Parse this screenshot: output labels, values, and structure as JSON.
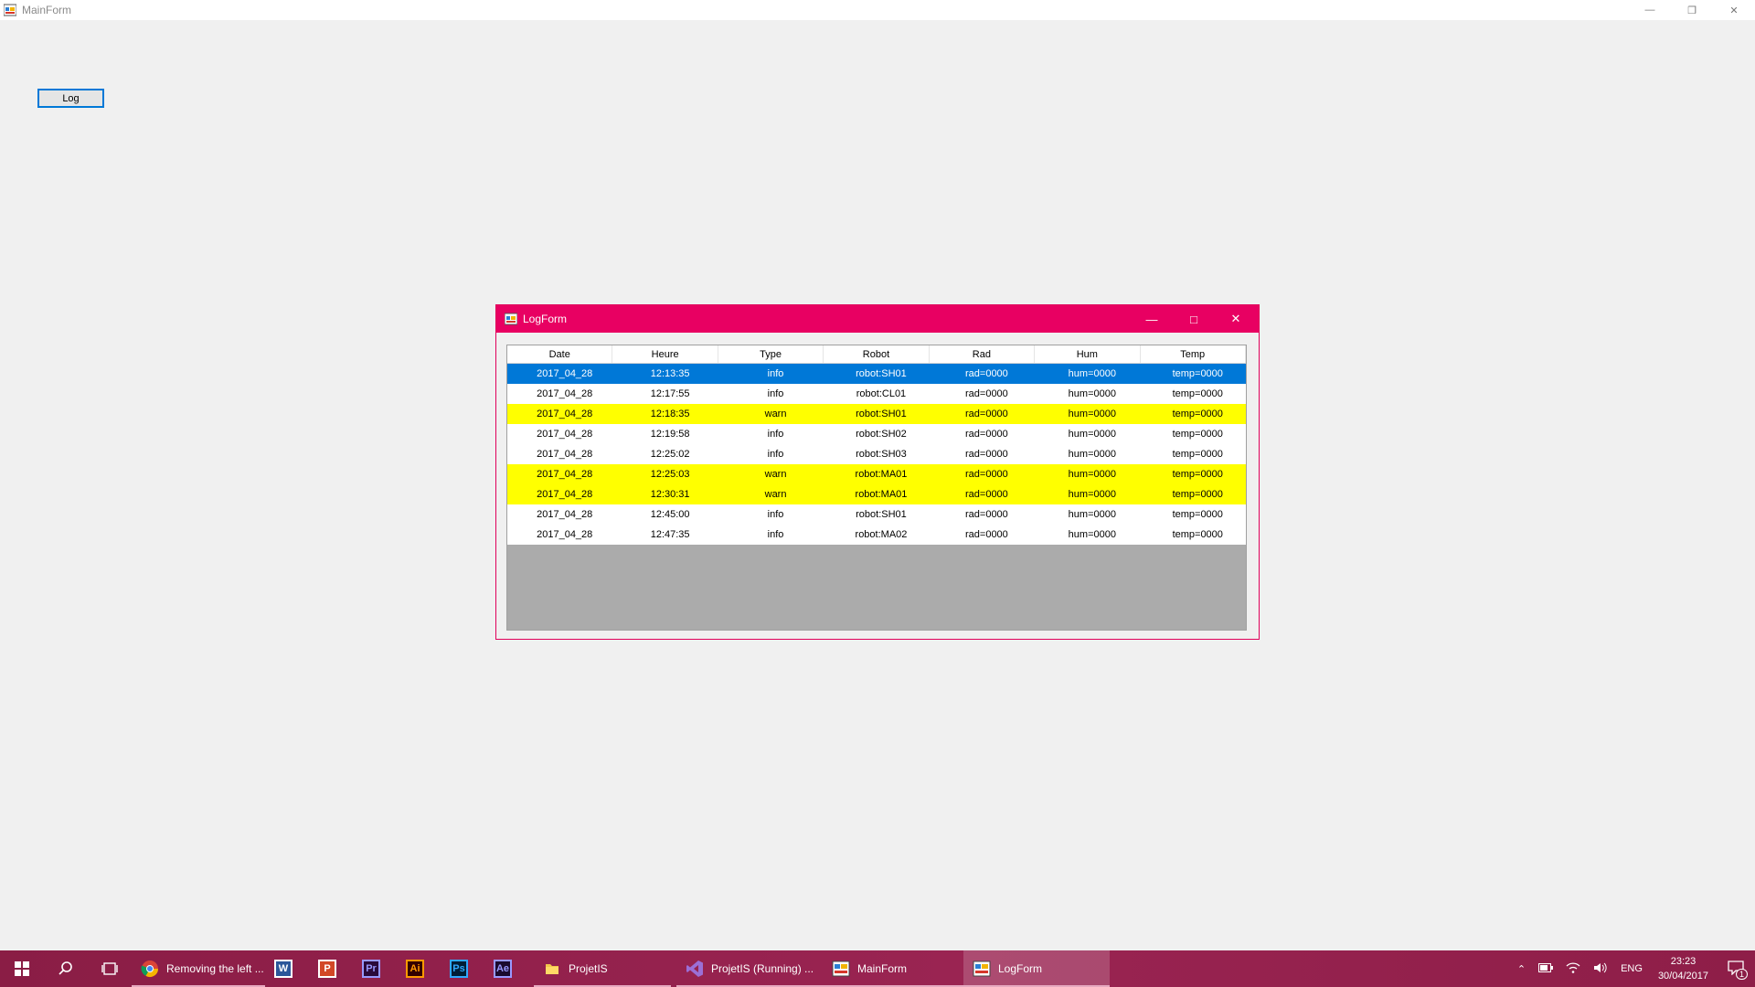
{
  "main_window": {
    "title": "MainForm",
    "log_button_label": "Log"
  },
  "log_window": {
    "title": "LogForm",
    "columns": [
      "Date",
      "Heure",
      "Type",
      "Robot",
      "Rad",
      "Hum",
      "Temp"
    ],
    "rows": [
      {
        "cells": [
          "2017_04_28",
          "12:13:35",
          "info",
          "robot:SH01",
          "rad=0000",
          "hum=0000",
          "temp=0000"
        ],
        "state": "selected"
      },
      {
        "cells": [
          "2017_04_28",
          "12:17:55",
          "info",
          "robot:CL01",
          "rad=0000",
          "hum=0000",
          "temp=0000"
        ],
        "state": "normal"
      },
      {
        "cells": [
          "2017_04_28",
          "12:18:35",
          "warn",
          "robot:SH01",
          "rad=0000",
          "hum=0000",
          "temp=0000"
        ],
        "state": "warn"
      },
      {
        "cells": [
          "2017_04_28",
          "12:19:58",
          "info",
          "robot:SH02",
          "rad=0000",
          "hum=0000",
          "temp=0000"
        ],
        "state": "normal"
      },
      {
        "cells": [
          "2017_04_28",
          "12:25:02",
          "info",
          "robot:SH03",
          "rad=0000",
          "hum=0000",
          "temp=0000"
        ],
        "state": "normal"
      },
      {
        "cells": [
          "2017_04_28",
          "12:25:03",
          "warn",
          "robot:MA01",
          "rad=0000",
          "hum=0000",
          "temp=0000"
        ],
        "state": "warn"
      },
      {
        "cells": [
          "2017_04_28",
          "12:30:31",
          "warn",
          "robot:MA01",
          "rad=0000",
          "hum=0000",
          "temp=0000"
        ],
        "state": "warn"
      },
      {
        "cells": [
          "2017_04_28",
          "12:45:00",
          "info",
          "robot:SH01",
          "rad=0000",
          "hum=0000",
          "temp=0000"
        ],
        "state": "normal"
      },
      {
        "cells": [
          "2017_04_28",
          "12:47:35",
          "info",
          "robot:MA02",
          "rad=0000",
          "hum=0000",
          "temp=0000"
        ],
        "state": "normal"
      }
    ],
    "colors": {
      "selected": "#0078d7",
      "warn": "#ffff00",
      "titlebar": "#e80062",
      "empty_area": "#ababab"
    }
  },
  "taskbar": {
    "apps": [
      {
        "id": "chrome",
        "label": "Removing the left ...",
        "icon": "chrome-icon",
        "running": true
      },
      {
        "id": "word",
        "label": "",
        "icon": "word-icon",
        "glyph": "W",
        "running": false
      },
      {
        "id": "powerpoint",
        "label": "",
        "icon": "powerpoint-icon",
        "glyph": "P",
        "running": false
      },
      {
        "id": "premiere",
        "label": "",
        "icon": "premiere-icon",
        "glyph": "Pr",
        "running": false
      },
      {
        "id": "illustrator",
        "label": "",
        "icon": "illustrator-icon",
        "glyph": "Ai",
        "running": false
      },
      {
        "id": "photoshop",
        "label": "",
        "icon": "photoshop-icon",
        "glyph": "Ps",
        "running": false
      },
      {
        "id": "aftereffects",
        "label": "",
        "icon": "after-effects-icon",
        "glyph": "Ae",
        "running": false
      },
      {
        "id": "explorer",
        "label": "ProjetIS",
        "icon": "folder-icon",
        "running": true
      },
      {
        "id": "vs",
        "label": "ProjetIS (Running) ...",
        "icon": "visual-studio-icon",
        "running": true
      },
      {
        "id": "mainform",
        "label": "MainForm",
        "icon": "form-icon",
        "running": true
      },
      {
        "id": "logform",
        "label": "LogForm",
        "icon": "form-icon",
        "running": true,
        "active": true
      }
    ],
    "tray": {
      "language": "ENG",
      "time": "23:23",
      "date": "30/04/2017",
      "notification_count": "1"
    }
  }
}
